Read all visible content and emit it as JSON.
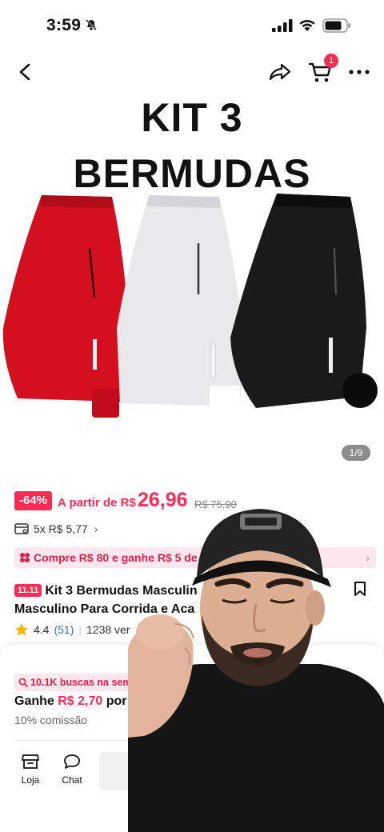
{
  "status_bar": {
    "time": "3:59",
    "icons": [
      "bell-slash-icon",
      "signal-icon",
      "wifi-icon",
      "battery-icon"
    ]
  },
  "nav": {
    "cart_count": "1",
    "icons": [
      "back-icon",
      "share-icon",
      "cart-icon",
      "more-icon"
    ]
  },
  "hero": {
    "line1": "KIT 3",
    "line2": "BERMUDAS",
    "image_counter": "1/9",
    "shorts_colors": [
      "#d4101f",
      "#e9e9ec",
      "#1a1a1a"
    ]
  },
  "price": {
    "discount": "-64%",
    "from_label": "A partir de R$",
    "current": "26,96",
    "original": "R$ 75,90"
  },
  "installments": "5x R$ 5,77",
  "promo": "Compre R$ 80 e ganhe R$ 5 de desconto | 6% cor",
  "product": {
    "badge": "11.11",
    "title_line1": "Kit 3 Bermudas Masculin",
    "title_line2": "Masculino Para Corrida e Aca",
    "rating": "4.4",
    "reviews": "(51)",
    "sold": "1238 ver"
  },
  "affiliate": {
    "searches": "10.1K buscas na sem",
    "earn_prefix": "Ganhe",
    "earn_amount": "R$ 2,70",
    "earn_suffix": "por",
    "commission": "10% comissão"
  },
  "bottom_nav": {
    "store_label": "Loja",
    "chat_label": "Chat"
  },
  "colors": {
    "accent": "#fe2c55",
    "promo_bg": "#fde7ee"
  }
}
